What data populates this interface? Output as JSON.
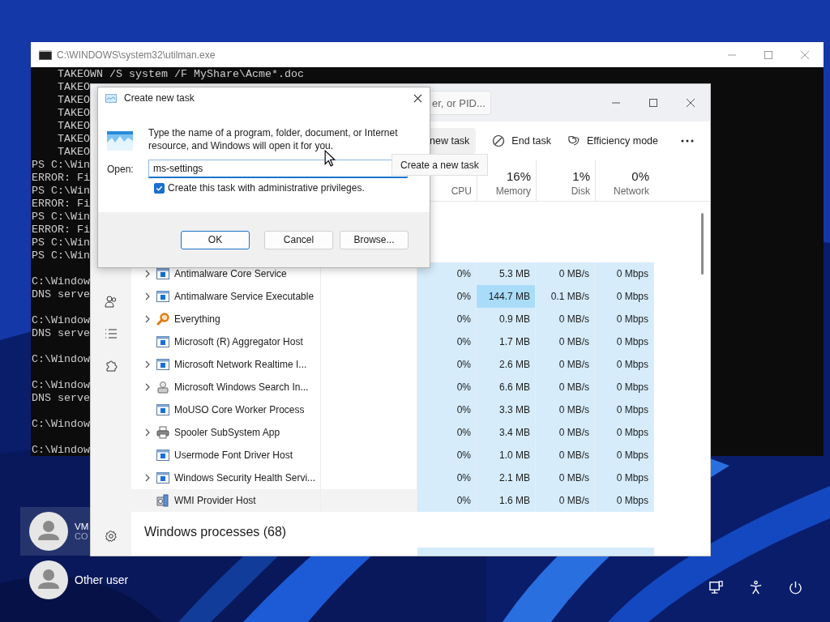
{
  "users": [
    {
      "name": "VM",
      "subtitle": "CO",
      "selected": true
    },
    {
      "name": "Other user",
      "selected": false
    }
  ],
  "console": {
    "title": "C:\\WINDOWS\\system32\\utilman.exe",
    "blocks": [
      {
        "lines": [
          "    TAKEOWN /S system /F MyShare\\Acme*.doc",
          "    TAKEO",
          "    TAKEO",
          "    TAKEO",
          "    TAKEO",
          "    TAKEO",
          "    TAKEO",
          "PS C:\\Win",
          "ERROR: Fi",
          "PS C:\\Win",
          "ERROR: Fi",
          "PS C:\\Win",
          "ERROR: Fi",
          "PS C:\\Win",
          "PS C:\\Win"
        ]
      },
      {
        "lines": [
          "C:\\Window",
          "DNS serve"
        ]
      },
      {
        "lines": [
          "C:\\Window",
          "DNS serve"
        ]
      },
      {
        "lines": [
          "C:\\Window"
        ]
      },
      {
        "lines": [
          "C:\\Window",
          "DNS serve"
        ]
      },
      {
        "lines": [
          "C:\\Window"
        ]
      },
      {
        "lines": [
          "C:\\Window"
        ]
      }
    ]
  },
  "task_manager": {
    "search": {
      "placeholder": "er, or PID..."
    },
    "toolbar": [
      {
        "kind": "run",
        "label": "new task",
        "hovered": true
      },
      {
        "kind": "end",
        "label": "End task",
        "hovered": false
      },
      {
        "kind": "efficiency",
        "label": "Efficiency mode",
        "hovered": false
      },
      {
        "kind": "more",
        "hovered": false
      }
    ],
    "tooltip": "Create a new task",
    "columns": [
      {
        "label": "CPU"
      },
      {
        "percent": "16%",
        "label": "Memory"
      },
      {
        "percent": "1%",
        "label": "Disk"
      },
      {
        "percent": "0%",
        "label": "Network"
      }
    ],
    "rows": [
      {
        "name": "Antimalware Core Service",
        "kind": "service",
        "expandable": true,
        "hovered": false,
        "cpu": "0%",
        "memory": "5.3 MB",
        "memory_hot": false,
        "disk": "0 MB/s",
        "network": "0 Mbps"
      },
      {
        "name": "Antimalware Service Executable",
        "kind": "service",
        "expandable": true,
        "hovered": false,
        "cpu": "0%",
        "memory": "144.7 MB",
        "memory_hot": true,
        "disk": "0.1 MB/s",
        "network": "0 Mbps"
      },
      {
        "name": "Everything",
        "kind": "search",
        "expandable": true,
        "hovered": false,
        "cpu": "0%",
        "memory": "0.9 MB",
        "memory_hot": false,
        "disk": "0 MB/s",
        "network": "0 Mbps"
      },
      {
        "name": "Microsoft (R) Aggregator Host",
        "kind": "service",
        "expandable": false,
        "hovered": false,
        "cpu": "0%",
        "memory": "1.7 MB",
        "memory_hot": false,
        "disk": "0 MB/s",
        "network": "0 Mbps"
      },
      {
        "name": "Microsoft Network Realtime I...",
        "kind": "service",
        "expandable": true,
        "hovered": false,
        "cpu": "0%",
        "memory": "2.6 MB",
        "memory_hot": false,
        "disk": "0 MB/s",
        "network": "0 Mbps"
      },
      {
        "name": "Microsoft Windows Search In...",
        "kind": "indexer",
        "expandable": true,
        "hovered": false,
        "cpu": "0%",
        "memory": "6.6 MB",
        "memory_hot": false,
        "disk": "0 MB/s",
        "network": "0 Mbps"
      },
      {
        "name": "MoUSO Core Worker Process",
        "kind": "service",
        "expandable": false,
        "hovered": false,
        "cpu": "0%",
        "memory": "3.3 MB",
        "memory_hot": false,
        "disk": "0 MB/s",
        "network": "0 Mbps"
      },
      {
        "name": "Spooler SubSystem App",
        "kind": "printer",
        "expandable": true,
        "hovered": false,
        "cpu": "0%",
        "memory": "3.4 MB",
        "memory_hot": false,
        "disk": "0 MB/s",
        "network": "0 Mbps"
      },
      {
        "name": "Usermode Font Driver Host",
        "kind": "service",
        "expandable": false,
        "hovered": false,
        "cpu": "0%",
        "memory": "1.0 MB",
        "memory_hot": false,
        "disk": "0 MB/s",
        "network": "0 Mbps"
      },
      {
        "name": "Windows Security Health Servi...",
        "kind": "service",
        "expandable": true,
        "hovered": false,
        "cpu": "0%",
        "memory": "2.1 MB",
        "memory_hot": false,
        "disk": "0 MB/s",
        "network": "0 Mbps"
      },
      {
        "name": "WMI Provider Host",
        "kind": "provider",
        "expandable": false,
        "hovered": true,
        "cpu": "0%",
        "memory": "1.6 MB",
        "memory_hot": false,
        "disk": "0 MB/s",
        "network": "0 Mbps"
      }
    ],
    "group": {
      "title": "Windows processes (68)"
    }
  },
  "dialog": {
    "title": "Create new task",
    "description": "Type the name of a program, folder, document, or Internet resource, and Windows will open it for you.",
    "open_label": "Open:",
    "value": "ms-settings",
    "checkbox": {
      "label": "Create this task with administrative privileges.",
      "checked": true
    },
    "buttons": [
      {
        "label": "OK",
        "default": true
      },
      {
        "label": "Cancel",
        "default": false
      },
      {
        "label": "Browse...",
        "default": false
      }
    ]
  }
}
